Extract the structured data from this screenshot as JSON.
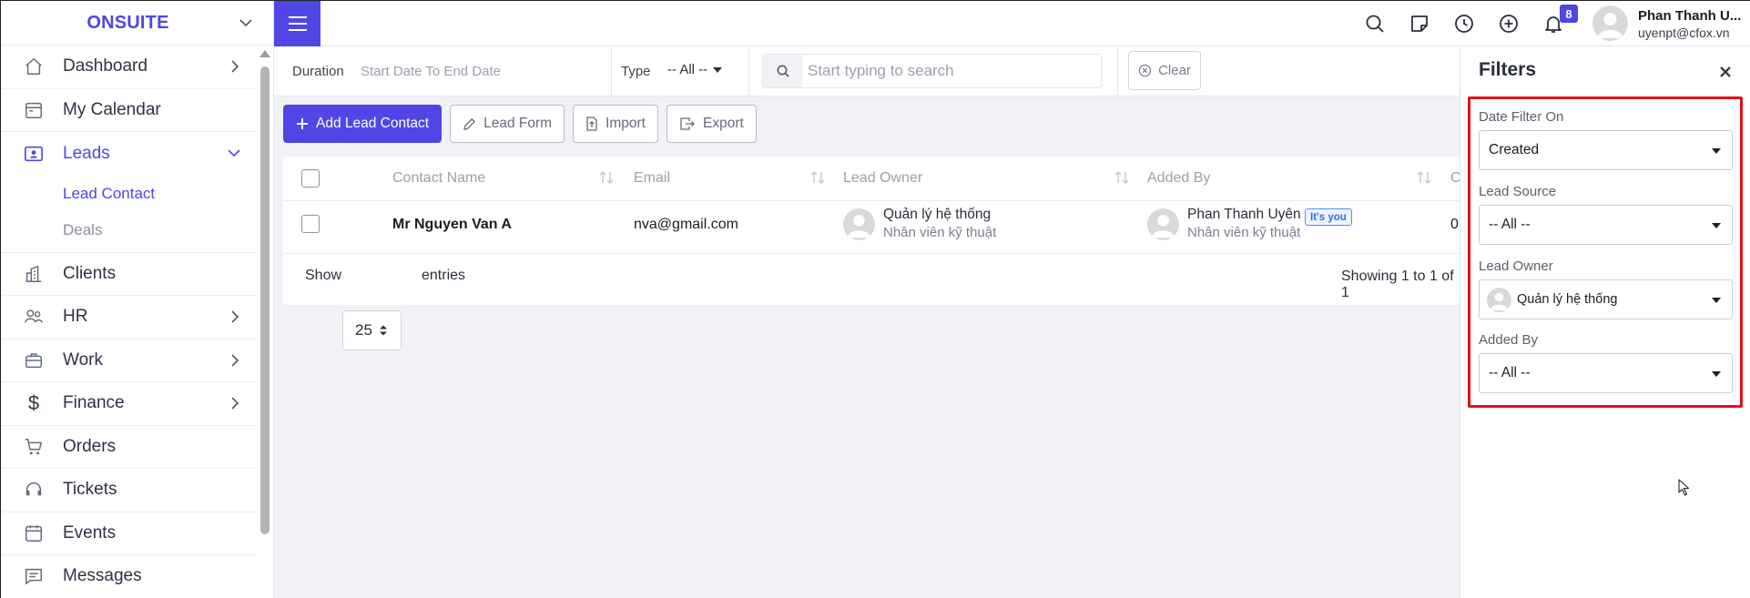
{
  "brand": {
    "name": "ONSUITE"
  },
  "sidebar": {
    "items": [
      {
        "label": "Dashboard",
        "icon": "home-icon",
        "has_chevron": true
      },
      {
        "label": "My Calendar",
        "icon": "calendar-icon",
        "has_chevron": false
      },
      {
        "label": "Leads",
        "icon": "contact-card-icon",
        "has_chevron": true,
        "expanded": true,
        "active": true
      },
      {
        "label": "Clients",
        "icon": "building-icon",
        "has_chevron": false
      },
      {
        "label": "HR",
        "icon": "people-icon",
        "has_chevron": true
      },
      {
        "label": "Work",
        "icon": "briefcase-icon",
        "has_chevron": true
      },
      {
        "label": "Finance",
        "icon": "dollar-icon",
        "has_chevron": true
      },
      {
        "label": "Orders",
        "icon": "cart-icon",
        "has_chevron": false
      },
      {
        "label": "Tickets",
        "icon": "headset-icon",
        "has_chevron": false
      },
      {
        "label": "Events",
        "icon": "calendar-icon",
        "has_chevron": false
      },
      {
        "label": "Messages",
        "icon": "message-icon",
        "has_chevron": false
      }
    ],
    "leads_sub": [
      {
        "label": "Lead Contact",
        "active": true
      },
      {
        "label": "Deals",
        "active": false
      }
    ]
  },
  "header": {
    "notification_count": "8",
    "user_name": "Phan Thanh U...",
    "user_email": "uyenpt@cfox.vn"
  },
  "filterbar": {
    "duration_label": "Duration",
    "duration_value": "Start Date To End Date",
    "type_label": "Type",
    "type_value": "-- All --",
    "search_placeholder": "Start typing to search",
    "clear_label": "Clear"
  },
  "actions": {
    "add_lead_contact": "Add Lead Contact",
    "lead_form": "Lead Form",
    "import": "Import",
    "export": "Export"
  },
  "table": {
    "columns": [
      "Contact Name",
      "Email",
      "Lead Owner",
      "Added By",
      "C"
    ],
    "rows": [
      {
        "contact_name": "Mr Nguyen Van A",
        "email": "nva@gmail.com",
        "lead_owner_name": "Quản lý hệ thống",
        "lead_owner_role": "Nhân viên kỹ thuật",
        "added_by_name": "Phan Thanh Uyên",
        "added_by_badge": "It's you",
        "added_by_role": "Nhân viên kỹ thuật",
        "cut_col": "0"
      }
    ],
    "show_label": "Show",
    "entries_value": "25",
    "entries_label": "entries",
    "showing_text": "Showing 1 to 1 of 1"
  },
  "filters_panel": {
    "title": "Filters",
    "date_filter_label": "Date Filter On",
    "date_filter_value": "Created",
    "lead_source_label": "Lead Source",
    "lead_source_value": "-- All --",
    "lead_owner_label": "Lead Owner",
    "lead_owner_value": "Quản lý hệ thống",
    "added_by_label": "Added By",
    "added_by_value": "-- All --"
  },
  "colors": {
    "accent": "#4f46e5",
    "highlight_border": "#e5101a",
    "background": "#f1f2f6"
  }
}
